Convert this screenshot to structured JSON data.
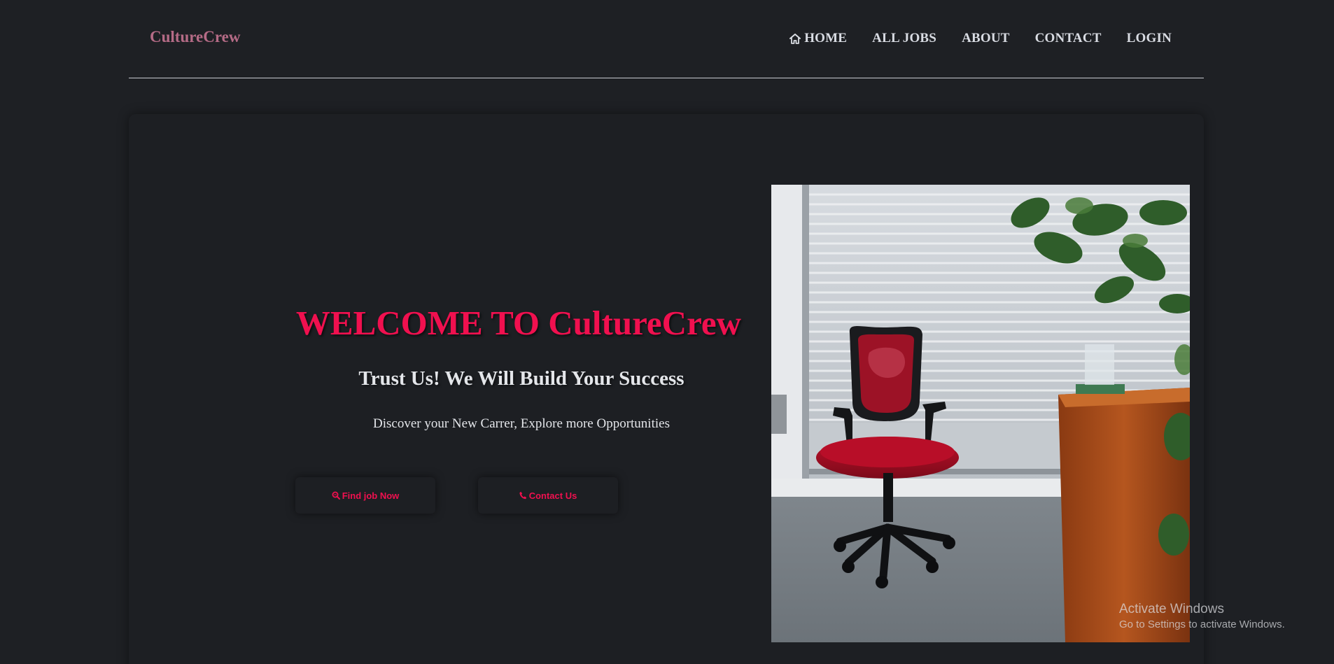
{
  "navbar": {
    "brand": "CultureCrew",
    "links": [
      {
        "label": "HOME",
        "icon": "home-icon"
      },
      {
        "label": "ALL JOBS"
      },
      {
        "label": "ABOUT"
      },
      {
        "label": "CONTACT"
      },
      {
        "label": "LOGIN"
      }
    ]
  },
  "hero": {
    "title": "WELCOME TO CultureCrew",
    "subtitle": "Trust Us! We Will Build Your Success",
    "description": "Discover your New Carrer, Explore more Opportunities",
    "buttons": {
      "find_job": {
        "label": "Find job Now",
        "icon": "search-icon"
      },
      "contact": {
        "label": "Contact Us",
        "icon": "phone-icon"
      }
    },
    "image_icon": "office-chair-photo"
  },
  "watermark": {
    "title": "Activate Windows",
    "subtitle": "Go to Settings to activate Windows."
  },
  "colors": {
    "background": "#1e2024",
    "accent": "#f0104f",
    "brand": "#b56b86",
    "nav_text": "#d9dce3"
  }
}
